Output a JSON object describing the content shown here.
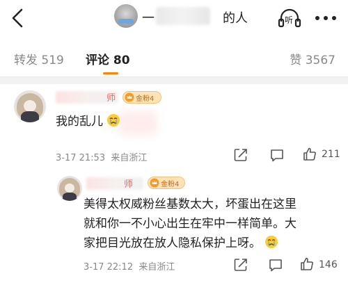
{
  "header": {
    "title_prefix": "一",
    "title_suffix": "的人",
    "listen_label": "听",
    "icons": [
      "back-arrow-icon",
      "headphones-icon",
      "more-dots-icon"
    ]
  },
  "tabs": {
    "repost": "转发 519",
    "comment": "评论 80",
    "like": "赞 3567",
    "accent": "#ff8200"
  },
  "comments": [
    {
      "name_tail": "师",
      "badge": "金粉4",
      "text": "我的乱儿",
      "emoji": "crying-face",
      "time": "3-17 21:53",
      "location": "来自浙江",
      "likes": "211",
      "reply": {
        "name_tail": "师",
        "badge": "金粉4",
        "lines": [
          "美得太权威粉丝基数太大，坏蛋出在这里",
          "就和你一不小心出生在牢中一样简单。大",
          "家把目光放在放人隐私保护上呀。"
        ],
        "emoji": "crying-face",
        "time": "3-17 22:12",
        "location": "来自浙江",
        "likes": "146"
      }
    }
  ]
}
